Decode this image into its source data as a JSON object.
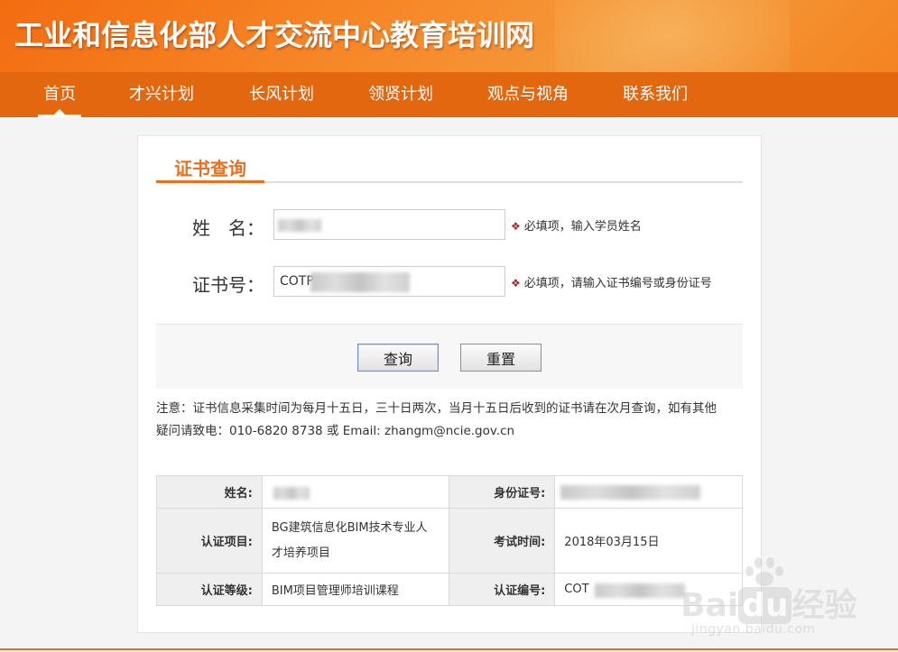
{
  "header": {
    "site_title": "工业和信息化部人才交流中心教育培训网"
  },
  "nav": {
    "items": [
      {
        "label": "首页",
        "active": true
      },
      {
        "label": "才兴计划"
      },
      {
        "label": "长风计划"
      },
      {
        "label": "领贤计划"
      },
      {
        "label": "观点与视角"
      },
      {
        "label": "联系我们"
      }
    ]
  },
  "form": {
    "section_title": "证书查询",
    "name_label": "姓　名：",
    "name_hint": "必填项，输入学员姓名",
    "cert_label": "证书号：",
    "cert_value": "COTP",
    "cert_hint": "必填项，请输入证书编号或身份证号",
    "query_button": "查询",
    "reset_button": "重置"
  },
  "notice": {
    "line1": "注意：证书信息采集时间为每月十五日，三十日两次，当月十五日后收到的证书请在次月查询，如有其他",
    "line2": "疑问请致电：010-6820 8738 或 Email: zhangm@ncie.gov.cn"
  },
  "result": {
    "name_label": "姓名:",
    "id_label": "身份证号:",
    "project_label": "认证项目:",
    "project_value_line1": "BG建筑信息化BIM技术专业人",
    "project_value_line2": "才培养项目",
    "exam_time_label": "考试时间:",
    "exam_time_value": "2018年03月15日",
    "level_label": "认证等级:",
    "level_value": "BIM项目管理师培训课程",
    "cert_no_label": "认证编号:",
    "cert_no_value": "COT"
  },
  "watermark": {
    "text_main": "Bai",
    "text_du": "du",
    "text_cn": "经验",
    "text_sub": "jingyan.baidu.com"
  }
}
